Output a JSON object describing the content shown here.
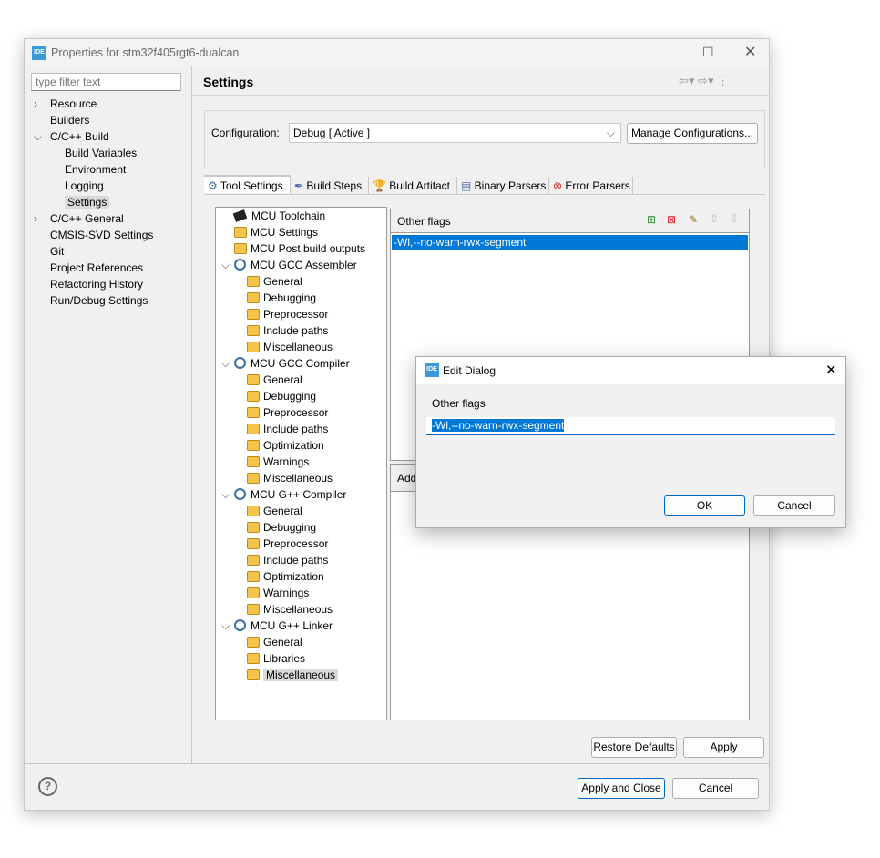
{
  "window": {
    "title": "Properties for stm32f405rgt6-dualcan",
    "icon_text": "IDE"
  },
  "filter": {
    "placeholder": "type filter text"
  },
  "nav": [
    {
      "label": "Resource",
      "depth": 0,
      "expander": "collapsed"
    },
    {
      "label": "Builders",
      "depth": 0
    },
    {
      "label": "C/C++ Build",
      "depth": 0,
      "expander": "expanded"
    },
    {
      "label": "Build Variables",
      "depth": 1
    },
    {
      "label": "Environment",
      "depth": 1
    },
    {
      "label": "Logging",
      "depth": 1
    },
    {
      "label": "Settings",
      "depth": 1,
      "selected": true
    },
    {
      "label": "C/C++ General",
      "depth": 0,
      "expander": "collapsed"
    },
    {
      "label": "CMSIS-SVD Settings",
      "depth": 0
    },
    {
      "label": "Git",
      "depth": 0
    },
    {
      "label": "Project References",
      "depth": 0
    },
    {
      "label": "Refactoring History",
      "depth": 0
    },
    {
      "label": "Run/Debug Settings",
      "depth": 0
    }
  ],
  "header": {
    "title": "Settings"
  },
  "config": {
    "label": "Configuration:",
    "value": "Debug  [ Active ]",
    "manage_label": "Manage Configurations..."
  },
  "tabs": [
    {
      "label": "Tool Settings",
      "icon": "tool-settings-icon",
      "active": true
    },
    {
      "label": "Build Steps",
      "icon": "build-steps-icon"
    },
    {
      "label": "Build Artifact",
      "icon": "trophy-icon"
    },
    {
      "label": "Binary Parsers",
      "icon": "binary-icon"
    },
    {
      "label": "Error Parsers",
      "icon": "error-icon"
    }
  ],
  "tool_tree": [
    {
      "label": "MCU Toolchain",
      "depth": 0,
      "icon": "chip"
    },
    {
      "label": "MCU Settings",
      "depth": 0,
      "icon": "folder"
    },
    {
      "label": "MCU Post build outputs",
      "depth": 0,
      "icon": "folder"
    },
    {
      "label": "MCU GCC Assembler",
      "depth": 0,
      "icon": "gear",
      "expander": true
    },
    {
      "label": "General",
      "depth": 1,
      "icon": "folder"
    },
    {
      "label": "Debugging",
      "depth": 1,
      "icon": "folder"
    },
    {
      "label": "Preprocessor",
      "depth": 1,
      "icon": "folder"
    },
    {
      "label": "Include paths",
      "depth": 1,
      "icon": "folder"
    },
    {
      "label": "Miscellaneous",
      "depth": 1,
      "icon": "folder"
    },
    {
      "label": "MCU GCC Compiler",
      "depth": 0,
      "icon": "gear",
      "expander": true
    },
    {
      "label": "General",
      "depth": 1,
      "icon": "folder"
    },
    {
      "label": "Debugging",
      "depth": 1,
      "icon": "folder"
    },
    {
      "label": "Preprocessor",
      "depth": 1,
      "icon": "folder"
    },
    {
      "label": "Include paths",
      "depth": 1,
      "icon": "folder"
    },
    {
      "label": "Optimization",
      "depth": 1,
      "icon": "folder"
    },
    {
      "label": "Warnings",
      "depth": 1,
      "icon": "folder"
    },
    {
      "label": "Miscellaneous",
      "depth": 1,
      "icon": "folder"
    },
    {
      "label": "MCU G++ Compiler",
      "depth": 0,
      "icon": "gear",
      "expander": true
    },
    {
      "label": "General",
      "depth": 1,
      "icon": "folder"
    },
    {
      "label": "Debugging",
      "depth": 1,
      "icon": "folder"
    },
    {
      "label": "Preprocessor",
      "depth": 1,
      "icon": "folder"
    },
    {
      "label": "Include paths",
      "depth": 1,
      "icon": "folder"
    },
    {
      "label": "Optimization",
      "depth": 1,
      "icon": "folder"
    },
    {
      "label": "Warnings",
      "depth": 1,
      "icon": "folder"
    },
    {
      "label": "Miscellaneous",
      "depth": 1,
      "icon": "folder"
    },
    {
      "label": "MCU G++ Linker",
      "depth": 0,
      "icon": "gear",
      "expander": true
    },
    {
      "label": "General",
      "depth": 1,
      "icon": "folder"
    },
    {
      "label": "Libraries",
      "depth": 1,
      "icon": "folder"
    },
    {
      "label": "Miscellaneous",
      "depth": 1,
      "icon": "folder",
      "selected": true
    }
  ],
  "flags": {
    "title": "Other flags",
    "items": [
      "-Wl,--no-warn-rwx-segment"
    ],
    "lower_title": "Add"
  },
  "buttons": {
    "restore": "Restore Defaults",
    "apply": "Apply",
    "apply_close": "Apply and Close",
    "cancel": "Cancel"
  },
  "dialog": {
    "title": "Edit Dialog",
    "icon_text": "IDE",
    "label": "Other flags",
    "value": "-Wl,--no-warn-rwx-segment",
    "ok": "OK",
    "cancel": "Cancel"
  },
  "colors": {
    "selection": "#0078d7",
    "accent": "#0067c0"
  }
}
